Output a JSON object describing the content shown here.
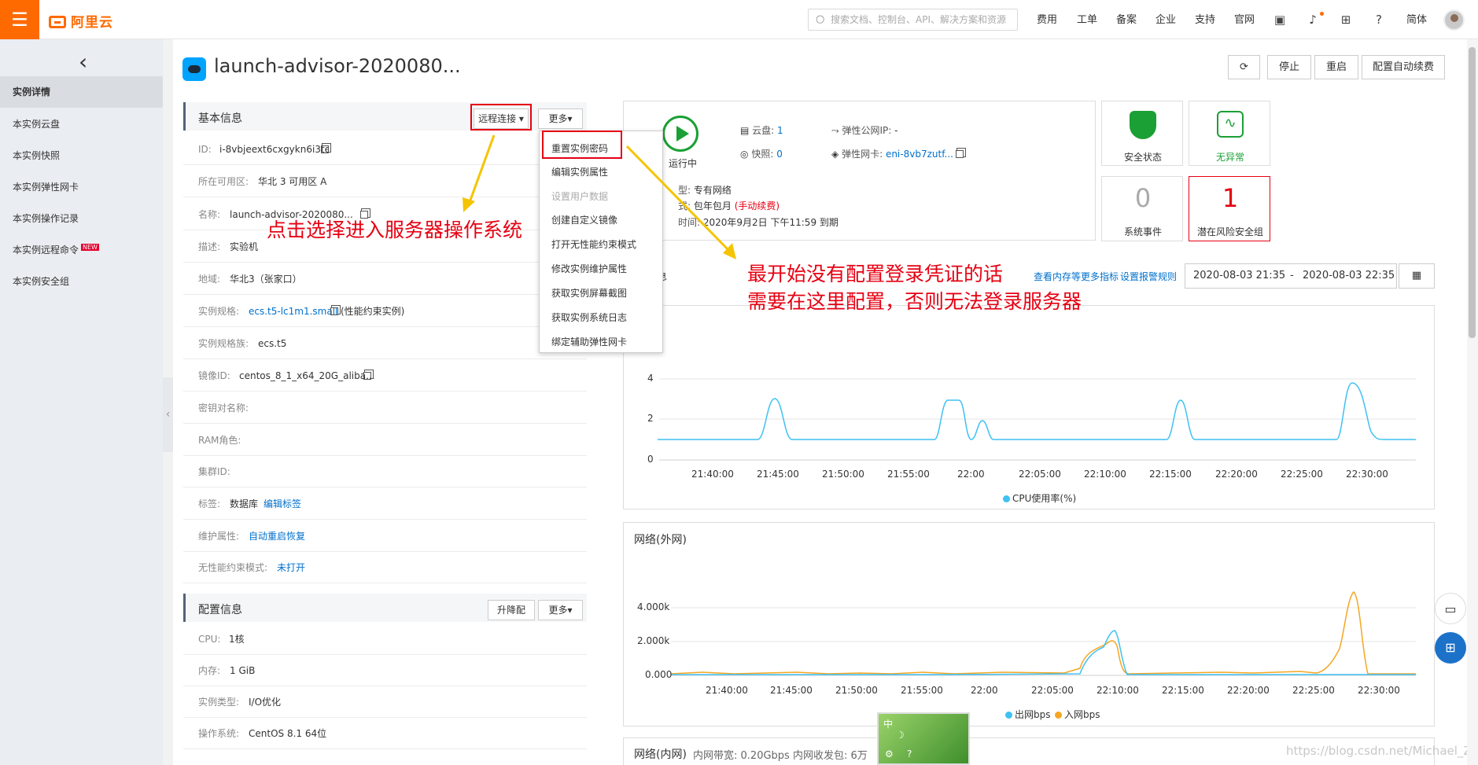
{
  "topbar": {
    "menu_icon": "hamburger-icon",
    "logo_text": "阿里云",
    "search_placeholder": "搜索文档、控制台、API、解决方案和资源",
    "nav": [
      "费用",
      "工单",
      "备案",
      "企业",
      "支持",
      "官网"
    ],
    "icons": [
      "terminal-icon",
      "bell-icon",
      "cart-icon",
      "help-icon"
    ],
    "lang": "简体"
  },
  "sidebar": {
    "back_icon": "chevron-left-icon",
    "items": [
      {
        "label": "实例详情",
        "active": true
      },
      {
        "label": "本实例云盘"
      },
      {
        "label": "本实例快照"
      },
      {
        "label": "本实例弹性网卡"
      },
      {
        "label": "本实例操作记录"
      },
      {
        "label": "本实例远程命令",
        "badge": "NEW"
      },
      {
        "label": "本实例安全组"
      }
    ]
  },
  "header": {
    "title": "launch-advisor-2020080...",
    "refresh_icon": "refresh-icon",
    "buttons": [
      "停止",
      "重启",
      "配置自动续费"
    ]
  },
  "basic_info": {
    "title": "基本信息",
    "remote_btn": "远程连接",
    "more_btn": "更多",
    "rows": [
      {
        "label": "ID:",
        "value": "i-8vbjeext6cxgykn6i3te"
      },
      {
        "label": "所在可用区:",
        "value": "华北 3 可用区 A"
      },
      {
        "label": "名称:",
        "value": "launch-advisor-2020080..."
      },
      {
        "label": "描述:",
        "value": "实验机"
      },
      {
        "label": "地域:",
        "value": "华北3（张家口）"
      },
      {
        "label": "实例规格:",
        "value": "ecs.t5-lc1m1.small",
        "extra": "(性能约束实例)"
      },
      {
        "label": "实例规格族:",
        "value": "ecs.t5"
      },
      {
        "label": "镜像ID:",
        "value": "centos_8_1_x64_20G_aliba..."
      },
      {
        "label": "密钥对名称:",
        "value": ""
      },
      {
        "label": "RAM角色:",
        "value": ""
      },
      {
        "label": "集群ID:",
        "value": ""
      },
      {
        "label": "标签:",
        "value": "数据库",
        "link": "编辑标签"
      },
      {
        "label": "维护属性:",
        "value": "",
        "link": "自动重启恢复"
      },
      {
        "label": "无性能约束模式:",
        "value": "",
        "link": "未打开"
      }
    ]
  },
  "dropdown": {
    "items": [
      {
        "label": "重置实例密码"
      },
      {
        "label": "编辑实例属性"
      },
      {
        "label": "设置用户数据",
        "disabled": true
      },
      {
        "label": "创建自定义镜像"
      },
      {
        "label": "打开无性能约束模式"
      },
      {
        "label": "修改实例维护属性"
      },
      {
        "label": "获取实例屏幕截图"
      },
      {
        "label": "获取实例系统日志"
      },
      {
        "label": "绑定辅助弹性网卡"
      }
    ]
  },
  "config_info": {
    "title": "配置信息",
    "upgrade_btn": "升降配",
    "more_btn": "更多",
    "rows": [
      {
        "label": "CPU:",
        "value": "1核"
      },
      {
        "label": "内存:",
        "value": "1 GiB"
      },
      {
        "label": "实例类型:",
        "value": "I/O优化"
      },
      {
        "label": "操作系统:",
        "value": "CentOS 8.1 64位"
      }
    ]
  },
  "annotations": {
    "left": "点击选择进入服务器操作系统",
    "right_line1": "最开始没有配置登录凭证的话",
    "right_line2": "需要在这里配置，否则无法登录服务器"
  },
  "status": {
    "running": "运行中",
    "disk_label": "云盘:",
    "disk_value": "1",
    "snapshot_label": "快照:",
    "snapshot_value": "0",
    "eip_label": "弹性公网IP:",
    "eip_value": "-",
    "eni_label": "弹性网卡:",
    "eni_value": "eni-8vb7zutf...",
    "net_type_suffix": "型:",
    "net_type": "专有网络",
    "pay_suffix": "式:",
    "pay": "包年包月",
    "pay_note": "(手动续费)",
    "expire_suffix": "时间:",
    "expire": "2020年9月2日 下午11:59 到期"
  },
  "security": {
    "safe_label": "安全状态",
    "normal_label": "无异常",
    "events_count": "0",
    "events_label": "系统事件",
    "risk_count": "1",
    "risk_label": "潜在风险安全组"
  },
  "monitor": {
    "partial_title": "息",
    "links": [
      "查看内存等更多指标",
      "设置报警规则"
    ],
    "range_start": "2020-08-03 21:35",
    "range_sep": "-",
    "range_end": "2020-08-03 22:35",
    "calendar_icon": "calendar-icon"
  },
  "cpu_chart": {
    "chart_data": {
      "type": "line",
      "x": [
        "21:35",
        "21:40:00",
        "21:45:00",
        "21:50:00",
        "21:55:00",
        "22:00",
        "22:05:00",
        "22:10:00",
        "22:15:00",
        "22:20:00",
        "22:25:00",
        "22:30:00",
        "22:35"
      ],
      "series": [
        {
          "name": "CPU使用率(%)",
          "color": "#3ec1f3"
        }
      ],
      "ylim": [
        0,
        4
      ],
      "yticks": [
        "0",
        "2",
        "4"
      ],
      "xticks": [
        "21:40:00",
        "21:45:00",
        "21:50:00",
        "21:55:00",
        "22:00",
        "22:05:00",
        "22:10:00",
        "22:15:00",
        "22:20:00",
        "22:25:00",
        "22:30:00"
      ]
    }
  },
  "net_chart": {
    "title": "网络(外网)",
    "chart_data": {
      "type": "line",
      "series": [
        {
          "name": "出网bps",
          "color": "#3ec1f3"
        },
        {
          "name": "入网bps",
          "color": "#f5a623"
        }
      ],
      "yticks": [
        "0.000",
        "2.000k",
        "4.000k"
      ],
      "xticks": [
        "21:40:00",
        "21:45:00",
        "21:50:00",
        "21:55:00",
        "22:00",
        "22:05:00",
        "22:10:00",
        "22:15:00",
        "22:20:00",
        "22:25:00",
        "22:30:00"
      ]
    }
  },
  "intranet": {
    "title": "网络(内网)",
    "bw_label": "内网带宽:",
    "bw_value": "0.20Gbps",
    "pps_label": "内网收发包:",
    "pps_value": "6万"
  },
  "floating": {
    "chat_icon": "chat-icon",
    "apps_icon": "apps-icon"
  },
  "ime_widget": {
    "text": "中",
    "moon": "☽",
    "help": "?"
  },
  "watermark": "https://blog.csdn.net/Michael_Zyy"
}
